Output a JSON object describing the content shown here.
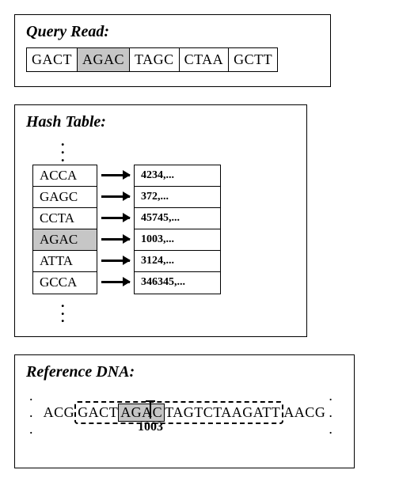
{
  "query": {
    "title": "Query Read:",
    "cells": [
      "GACT",
      "AGAC",
      "TAGC",
      "CTAA",
      "GCTT"
    ],
    "highlight_index": 1
  },
  "hash_table": {
    "title": "Hash Table:",
    "rows": [
      {
        "key": "ACCA",
        "value": "4234,..."
      },
      {
        "key": "GAGC",
        "value": "372,..."
      },
      {
        "key": "CCTA",
        "value": "45745,..."
      },
      {
        "key": "AGAC",
        "value": "1003,..."
      },
      {
        "key": "ATTA",
        "value": "3124,..."
      },
      {
        "key": "GCCA",
        "value": "346345,..."
      }
    ],
    "highlight_key": "AGAC"
  },
  "reference": {
    "title": "Reference DNA:",
    "prefix": "ACG",
    "before_hl": "GACT",
    "highlight": "AGAC",
    "after_hl": "TAGTCTAAGATT",
    "suffix": "AACG",
    "pointer_label": "1003",
    "ellipsis": ". . ."
  }
}
